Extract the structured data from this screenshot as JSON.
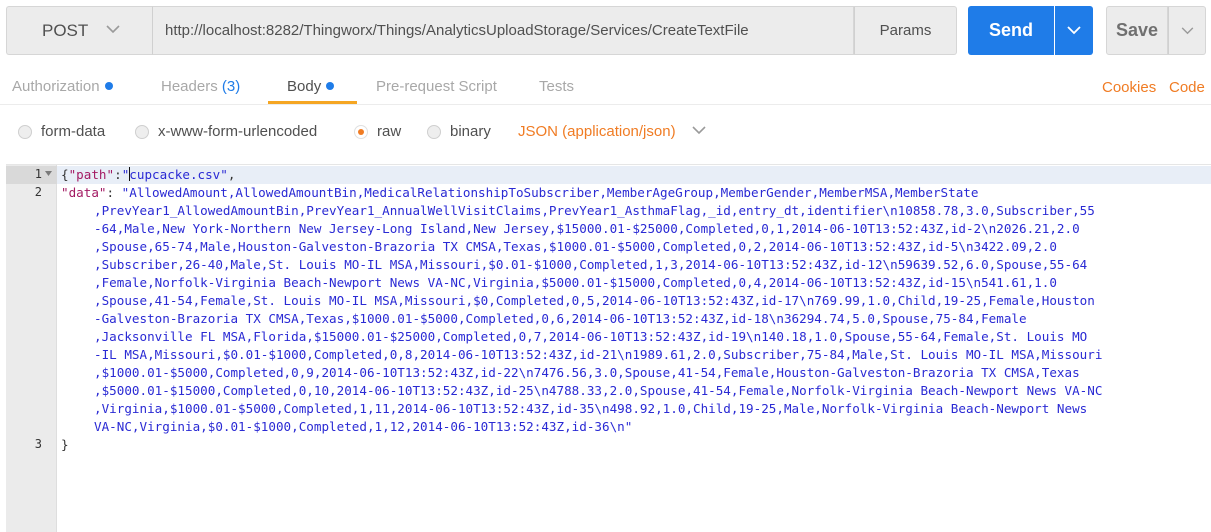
{
  "request": {
    "method": "POST",
    "url": "http://localhost:8282/Thingworx/Things/AnalyticsUploadStorage/Services/CreateTextFile",
    "params_label": "Params",
    "send_label": "Send",
    "save_label": "Save"
  },
  "tabs": [
    {
      "label": "Authorization"
    },
    {
      "label": "Headers",
      "count": "(3)"
    },
    {
      "label": "Body"
    },
    {
      "label": "Pre-request Script"
    },
    {
      "label": "Tests"
    }
  ],
  "links": {
    "cookies": "Cookies",
    "code": "Code"
  },
  "body_types": [
    "form-data",
    "x-www-form-urlencoded",
    "raw",
    "binary"
  ],
  "selected_body_type": "raw",
  "content_type": "JSON (application/json)",
  "editor": {
    "line_numbers": [
      "1",
      "2",
      "3"
    ],
    "line1": {
      "open": "{",
      "key": "\"path\"",
      "colon": ":",
      "quote": "\"",
      "value": "cupcacke.csv\"",
      "comma": ","
    },
    "line2": {
      "key": "\"data\"",
      "colon": ": ",
      "rows": [
        "\"AllowedAmount,AllowedAmountBin,MedicalRelationshipToSubscriber,MemberAgeGroup,MemberGender,MemberMSA,MemberState",
        ",PrevYear1_AllowedAmountBin,PrevYear1_AnnualWellVisitClaims,PrevYear1_AsthmaFlag,_id,entry_dt,identifier\\n10858.78,3.0,Subscriber,55",
        "-64,Male,New York-Northern New Jersey-Long Island,New Jersey,$15000.01-$25000,Completed,0,1,2014-06-10T13:52:43Z,id-2\\n2026.21,2.0",
        ",Spouse,65-74,Male,Houston-Galveston-Brazoria TX CMSA,Texas,$1000.01-$5000,Completed,0,2,2014-06-10T13:52:43Z,id-5\\n3422.09,2.0",
        ",Subscriber,26-40,Male,St. Louis MO-IL MSA,Missouri,$0.01-$1000,Completed,1,3,2014-06-10T13:52:43Z,id-12\\n59639.52,6.0,Spouse,55-64",
        ",Female,Norfolk-Virginia Beach-Newport News VA-NC,Virginia,$5000.01-$15000,Completed,0,4,2014-06-10T13:52:43Z,id-15\\n541.61,1.0",
        ",Spouse,41-54,Female,St. Louis MO-IL MSA,Missouri,$0,Completed,0,5,2014-06-10T13:52:43Z,id-17\\n769.99,1.0,Child,19-25,Female,Houston",
        "-Galveston-Brazoria TX CMSA,Texas,$1000.01-$5000,Completed,0,6,2014-06-10T13:52:43Z,id-18\\n36294.74,5.0,Spouse,75-84,Female",
        ",Jacksonville FL MSA,Florida,$15000.01-$25000,Completed,0,7,2014-06-10T13:52:43Z,id-19\\n140.18,1.0,Spouse,55-64,Female,St. Louis MO",
        "-IL MSA,Missouri,$0.01-$1000,Completed,0,8,2014-06-10T13:52:43Z,id-21\\n1989.61,2.0,Subscriber,75-84,Male,St. Louis MO-IL MSA,Missouri",
        ",$1000.01-$5000,Completed,0,9,2014-06-10T13:52:43Z,id-22\\n7476.56,3.0,Spouse,41-54,Female,Houston-Galveston-Brazoria TX CMSA,Texas",
        ",$5000.01-$15000,Completed,0,10,2014-06-10T13:52:43Z,id-25\\n4788.33,2.0,Spouse,41-54,Female,Norfolk-Virginia Beach-Newport News VA-NC",
        ",Virginia,$1000.01-$5000,Completed,1,11,2014-06-10T13:52:43Z,id-35\\n498.92,1.0,Child,19-25,Male,Norfolk-Virginia Beach-Newport News",
        "VA-NC,Virginia,$0.01-$1000,Completed,1,12,2014-06-10T13:52:43Z,id-36\\n\""
      ]
    },
    "line3": "}"
  },
  "colors": {
    "accent_blue": "#1f7ce8",
    "accent_orange": "#f07c24",
    "tab_underline": "#f5a623"
  },
  "icons": [
    "chevron-down-icon",
    "fold-arrow-icon",
    "status-dot-icon"
  ]
}
